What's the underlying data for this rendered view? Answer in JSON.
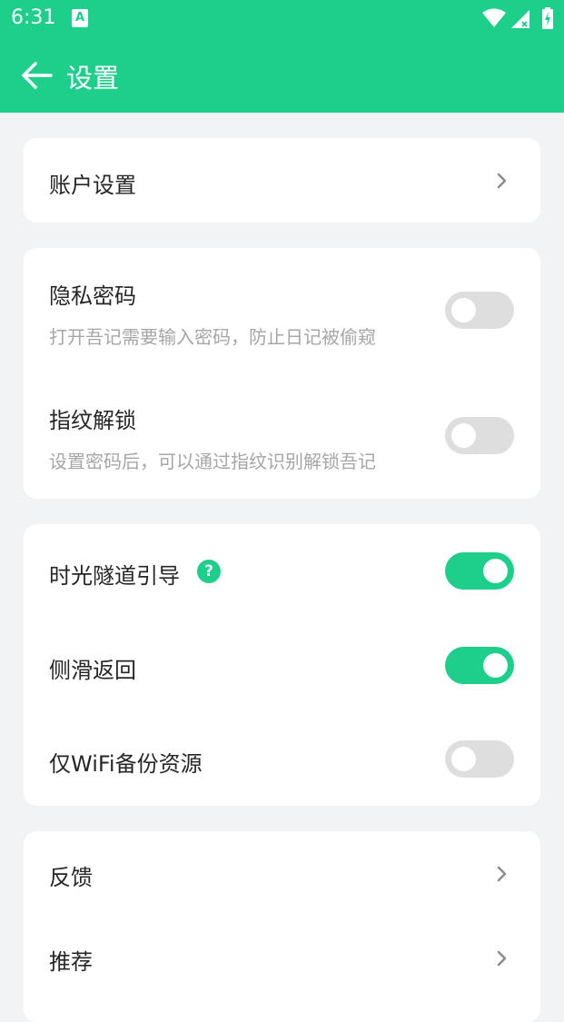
{
  "statusbar": {
    "time": "6:31",
    "notification_icon_label": "A"
  },
  "appbar": {
    "title": "设置"
  },
  "cards": {
    "account": {
      "label": "账户设置"
    },
    "privacy": {
      "password_title": "隐私密码",
      "password_desc": "打开吾记需要输入密码，防止日记被偷窥",
      "password_enabled": false,
      "fingerprint_title": "指纹解锁",
      "fingerprint_desc": "设置密码后，可以通过指纹识别解锁吾记",
      "fingerprint_enabled": false
    },
    "general": {
      "tunnel_title": "时光隧道引导",
      "tunnel_help": "?",
      "tunnel_enabled": true,
      "swipe_title": "侧滑返回",
      "swipe_enabled": true,
      "wifi_title": "仅WiFi备份资源",
      "wifi_enabled": false
    },
    "more": {
      "feedback_label": "反馈",
      "recommend_label": "推荐"
    }
  },
  "colors": {
    "accent": "#1ecf8c",
    "background": "#f2f3f5",
    "toggle_off": "#dedede"
  }
}
